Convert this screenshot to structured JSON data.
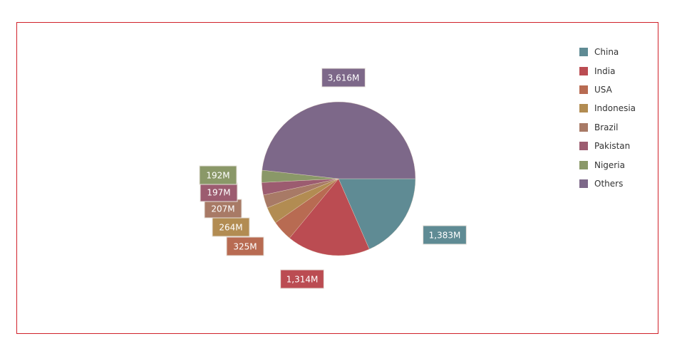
{
  "chart_data": {
    "type": "pie",
    "title": "",
    "units": "M",
    "start": "3 o'clock, clockwise",
    "legend_position": "right",
    "slices": [
      {
        "label": "China",
        "value": 1383,
        "display": "1,383M",
        "color": "#5f8b94"
      },
      {
        "label": "India",
        "value": 1314,
        "display": "1,314M",
        "color": "#bb4c52"
      },
      {
        "label": "USA",
        "value": 325,
        "display": "325M",
        "color": "#b86b52"
      },
      {
        "label": "Indonesia",
        "value": 264,
        "display": "264M",
        "color": "#b28c52"
      },
      {
        "label": "Brazil",
        "value": 207,
        "display": "207M",
        "color": "#a87a66"
      },
      {
        "label": "Pakistan",
        "value": 197,
        "display": "197M",
        "color": "#9c5c70"
      },
      {
        "label": "Nigeria",
        "value": 192,
        "display": "192M",
        "color": "#8a9868"
      },
      {
        "label": "Others",
        "value": 3616,
        "display": "3,616M",
        "color": "#7d6889"
      }
    ]
  },
  "legend": {
    "items": [
      "China",
      "India",
      "USA",
      "Indonesia",
      "Brazil",
      "Pakistan",
      "Nigeria",
      "Others"
    ]
  }
}
